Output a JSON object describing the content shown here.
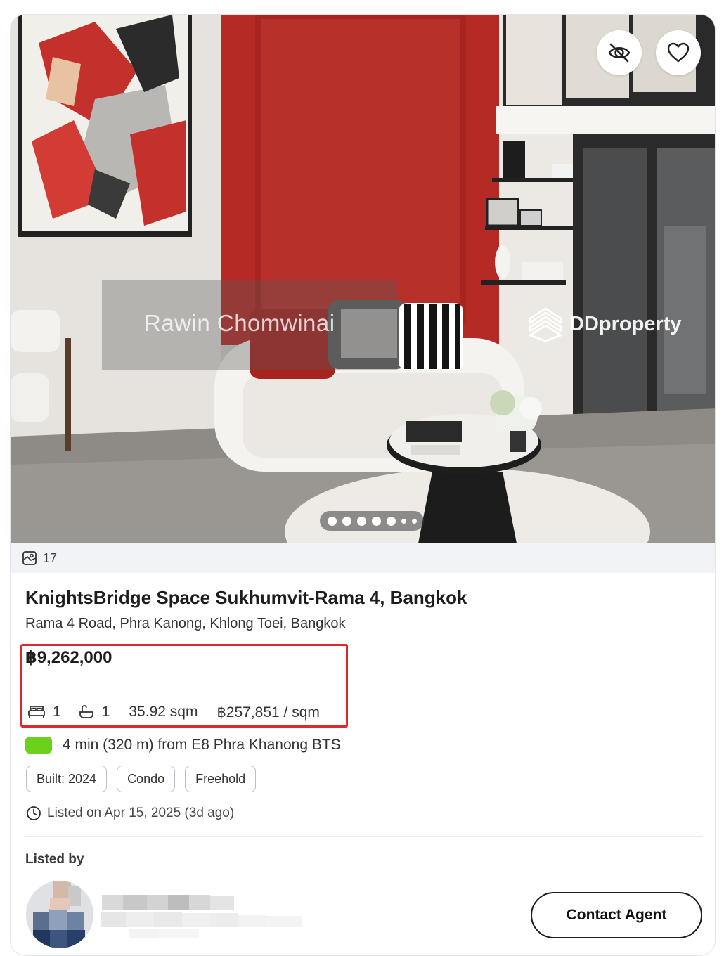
{
  "listing": {
    "photo": {
      "watermark_name": "Rawin Chomwinai",
      "watermark_brand": "DDproperty",
      "hide_icon": "eye-off-icon",
      "favorite_icon": "heart-icon",
      "image_count": "17",
      "carousel_dots": 7
    },
    "title": "KnightsBridge Space Sukhumvit-Rama 4, Bangkok",
    "address": "Rama 4 Road, Phra Kanong, Khlong Toei, Bangkok",
    "price": "฿9,262,000",
    "bedrooms": "1",
    "bathrooms": "1",
    "area": "35.92 sqm",
    "price_per_sqm": "฿257,851 / sqm",
    "transit": "4 min (320 m) from E8 Phra Khanong BTS",
    "tags": [
      "Built: 2024",
      "Condo",
      "Freehold"
    ],
    "listed_date": "Listed on Apr 15, 2025 (3d ago)",
    "listed_by_label": "Listed by",
    "contact_button": "Contact Agent"
  },
  "colors": {
    "highlight_box": "#e0282e",
    "bts_green": "#6cd11c",
    "accent_wall": "#b52a25"
  }
}
